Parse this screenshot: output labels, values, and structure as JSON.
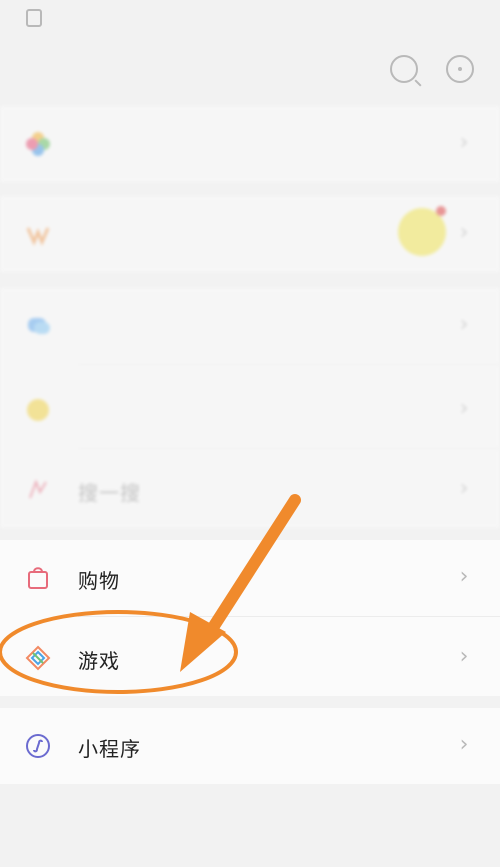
{
  "status_bar": {
    "left_text": "",
    "right_text": ""
  },
  "header": {
    "title": ""
  },
  "rows": [
    {
      "id": "moments",
      "label": "",
      "aux": ""
    },
    {
      "id": "channels",
      "label": "",
      "aux": ""
    },
    {
      "id": "scan",
      "label": "",
      "aux": ""
    },
    {
      "id": "shake",
      "label": "",
      "aux": ""
    },
    {
      "id": "search",
      "label": "搜一搜",
      "aux": ""
    },
    {
      "id": "shopping",
      "label": "购物",
      "aux": ""
    },
    {
      "id": "games",
      "label": "游戏",
      "aux": ""
    },
    {
      "id": "mini_programs",
      "label": "小程序",
      "aux": ""
    }
  ],
  "chevron": "›",
  "colors": {
    "annotation": "#f08a2c",
    "page_bg": "#f2f2f2",
    "cell_bg": "#fbfbfb"
  }
}
